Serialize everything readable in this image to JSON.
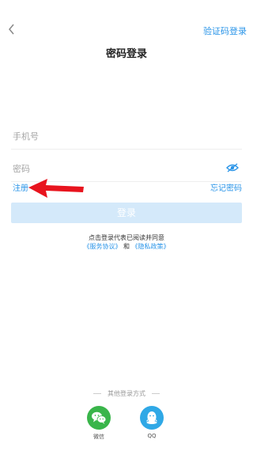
{
  "header": {
    "title": "密码登录",
    "switch_label": "验证码登录"
  },
  "form": {
    "phone_placeholder": "手机号",
    "password_placeholder": "密码",
    "register_label": "注册",
    "forgot_label": "忘记密码",
    "login_label": "登录"
  },
  "agreement": {
    "text": "点击登录代表已阅读并同意",
    "service_link": "《服务协议》",
    "and": "和",
    "privacy_link": "《隐私政策》"
  },
  "other_login": {
    "label": "其他登录方式",
    "wechat_label": "微信",
    "qq_label": "QQ"
  },
  "colors": {
    "accent": "#2b95e8",
    "login_button_disabled": "#d4e9fa",
    "wechat": "#39b54a",
    "qq": "#2fa8e6",
    "annotation_arrow": "#e8141e"
  },
  "icons": {
    "back": "chevron-left-icon",
    "password_visibility": "eye-off-icon",
    "annotation": "red-arrow-icon"
  }
}
